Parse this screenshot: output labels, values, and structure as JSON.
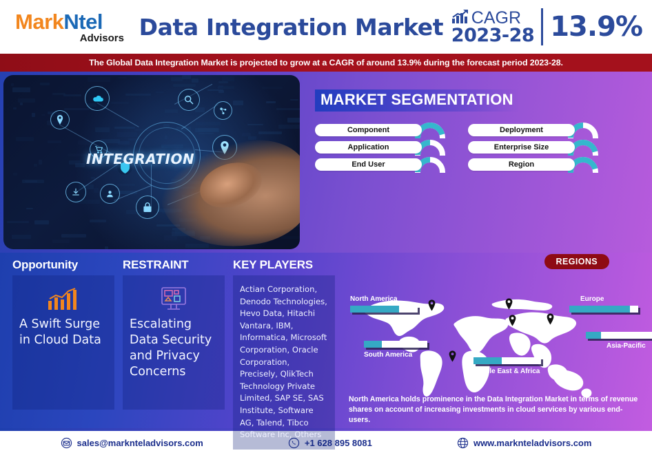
{
  "header": {
    "logo_mark": "Mark",
    "logo_ntel": "Ntel",
    "logo_sub": "Advisors",
    "title": "Data Integration Market",
    "cagr_label": "CAGR",
    "cagr_years": "2023-28",
    "cagr_value": "13.9%"
  },
  "banner": {
    "text": "The Global Data Integration Market is projected to grow at a CAGR of around 13.9% during the forecast period 2023-28."
  },
  "hero": {
    "word": "INTEGRATION",
    "nodes": [
      "cloud-icon",
      "search-icon",
      "share-network-icon",
      "map-pin-icon",
      "location-marker-icon",
      "cart-icon",
      "shield-icon",
      "download-icon",
      "user-icon",
      "lock-icon"
    ]
  },
  "segmentation": {
    "title": "MARKET SEGMENTATION",
    "left_items": [
      "Component",
      "Application",
      "End User"
    ],
    "right_items": [
      "Deployment",
      "Enterprise Size",
      "Region"
    ]
  },
  "cards": [
    {
      "title": "Opportunity",
      "icon": "growth-bar-chart-icon",
      "text": "A Swift Surge in Cloud Data"
    },
    {
      "title": "RESTRAINT",
      "icon": "monitor-security-icon",
      "text": "Escalating Data Security and Privacy Concerns"
    },
    {
      "title": "KEY PLAYERS",
      "icon": "none",
      "text": "Actian Corporation, Denodo Technologies, Hevo Data, Hitachi Vantara, IBM, Informatica, Microsoft Corporation, Oracle Corporation, Precisely, QlikTech Technology Private Limited, SAP SE, SAS Institute, Software AG, Talend, Tibco Software Inc, Others"
    }
  ],
  "regions": {
    "badge": "REGIONS",
    "note": "North America holds prominence in the Data Integration Market in terms of revenue shares on account of increasing investments in cloud services by various end-users.",
    "items": [
      {
        "name": "North America",
        "share": 72
      },
      {
        "name": "South America",
        "share": 28
      },
      {
        "name": "Europe",
        "share": 88
      },
      {
        "name": "Middle East & Africa",
        "share": 42
      },
      {
        "name": "Asia-Pacific",
        "share": 22
      }
    ]
  },
  "footer": {
    "email": "sales@marknteladvisors.com",
    "phone": "+1 628 895 8081",
    "website": "www.marknteladvisors.com",
    "email_icon": "envelope-icon",
    "phone_icon": "phone-icon",
    "website_icon": "globe-icon"
  },
  "colors": {
    "brand_orange": "#F2861E",
    "brand_blue": "#1B69B6",
    "title_blue": "#2B4A9B",
    "banner_red": "#A4111C",
    "badge_red": "#8E0B14",
    "teal": "#35A9C4"
  }
}
